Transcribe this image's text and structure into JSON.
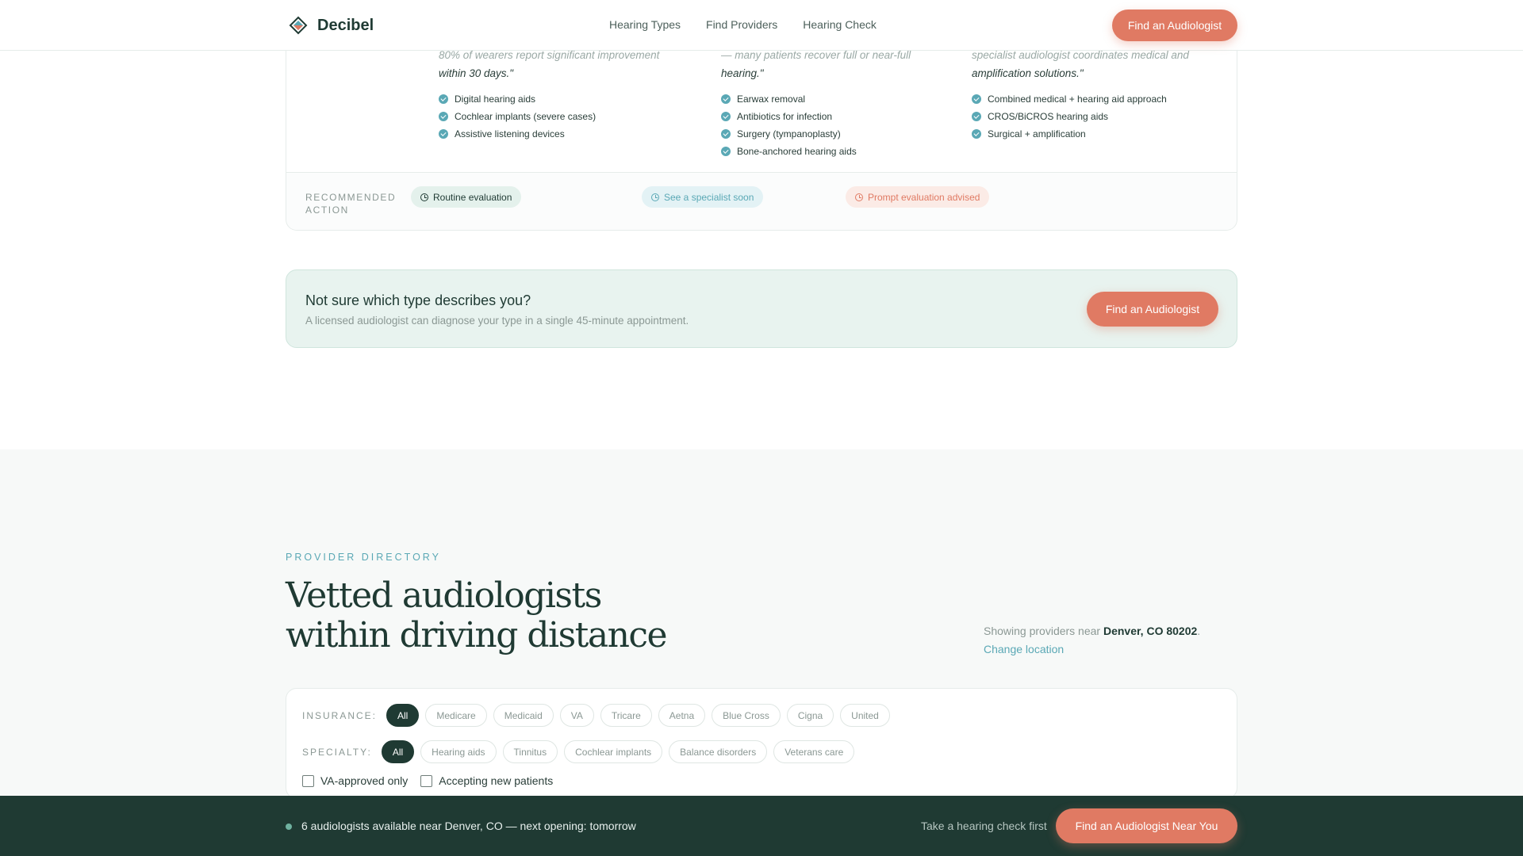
{
  "header": {
    "brand": "Decibel",
    "nav": [
      "Hearing Types",
      "Find Providers",
      "Hearing Check"
    ],
    "cta": "Find an Audiologist"
  },
  "comparison": {
    "columns": [
      {
        "quote_lead": "80% of wearers report significant improvement",
        "quote_end": "within 30 days.\"",
        "items": [
          "Digital hearing aids",
          "Cochlear implants (severe cases)",
          "Assistive listening devices"
        ],
        "status": "Routine evaluation",
        "status_color": "#1f3a33"
      },
      {
        "quote_lead": "— many patients recover full or near-full",
        "quote_end": "hearing.\"",
        "items": [
          "Earwax removal",
          "Antibiotics for infection",
          "Surgery (tympanoplasty)",
          "Bone-anchored hearing aids"
        ],
        "status": "See a specialist soon",
        "status_color": "#5aa8b5"
      },
      {
        "quote_lead": "specialist audiologist coordinates medical and",
        "quote_end": "amplification solutions.\"",
        "items": [
          "Combined medical + hearing aid approach",
          "CROS/BiCROS hearing aids",
          "Surgical + amplification"
        ],
        "status": "Prompt evaluation advised",
        "status_color": "#e07a63"
      }
    ],
    "recommended_label_1": "RECOMMENDED",
    "recommended_label_2": "ACTION"
  },
  "callout": {
    "title": "Not sure which type describes you?",
    "subtitle": "A licensed audiologist can diagnose your type in a single 45-minute appointment.",
    "cta": "Find an Audiologist"
  },
  "directory": {
    "eyebrow": "PROVIDER DIRECTORY",
    "title": "Vetted audiologists within driving distance",
    "location_prefix": "Showing providers near ",
    "location_city": "Denver, CO 80202",
    "location_suffix": ".",
    "change_location": "Change location",
    "insurance_label": "INSURANCE:",
    "insurance_options": [
      "All",
      "Medicare",
      "Medicaid",
      "VA",
      "Tricare",
      "Aetna",
      "Blue Cross",
      "Cigna",
      "United"
    ],
    "insurance_selected": "All",
    "specialty_label": "SPECIALTY:",
    "specialty_options": [
      "All",
      "Hearing aids",
      "Tinnitus",
      "Cochlear implants",
      "Balance disorders",
      "Veterans care"
    ],
    "specialty_selected": "All",
    "checkboxes": [
      {
        "label": "VA-approved only",
        "checked": false
      },
      {
        "label": "Accepting new patients",
        "checked": false
      }
    ]
  },
  "bottombar": {
    "status": "6 audiologists available near Denver, CO — next opening: tomorrow",
    "secondary_link": "Take a hearing check first",
    "cta": "Find an Audiologist Near You"
  },
  "colors": {
    "accent": "#e07a63",
    "primary_dark": "#1f3a33",
    "teal": "#5aa8b5",
    "mint_bg": "#e8f3ef"
  }
}
